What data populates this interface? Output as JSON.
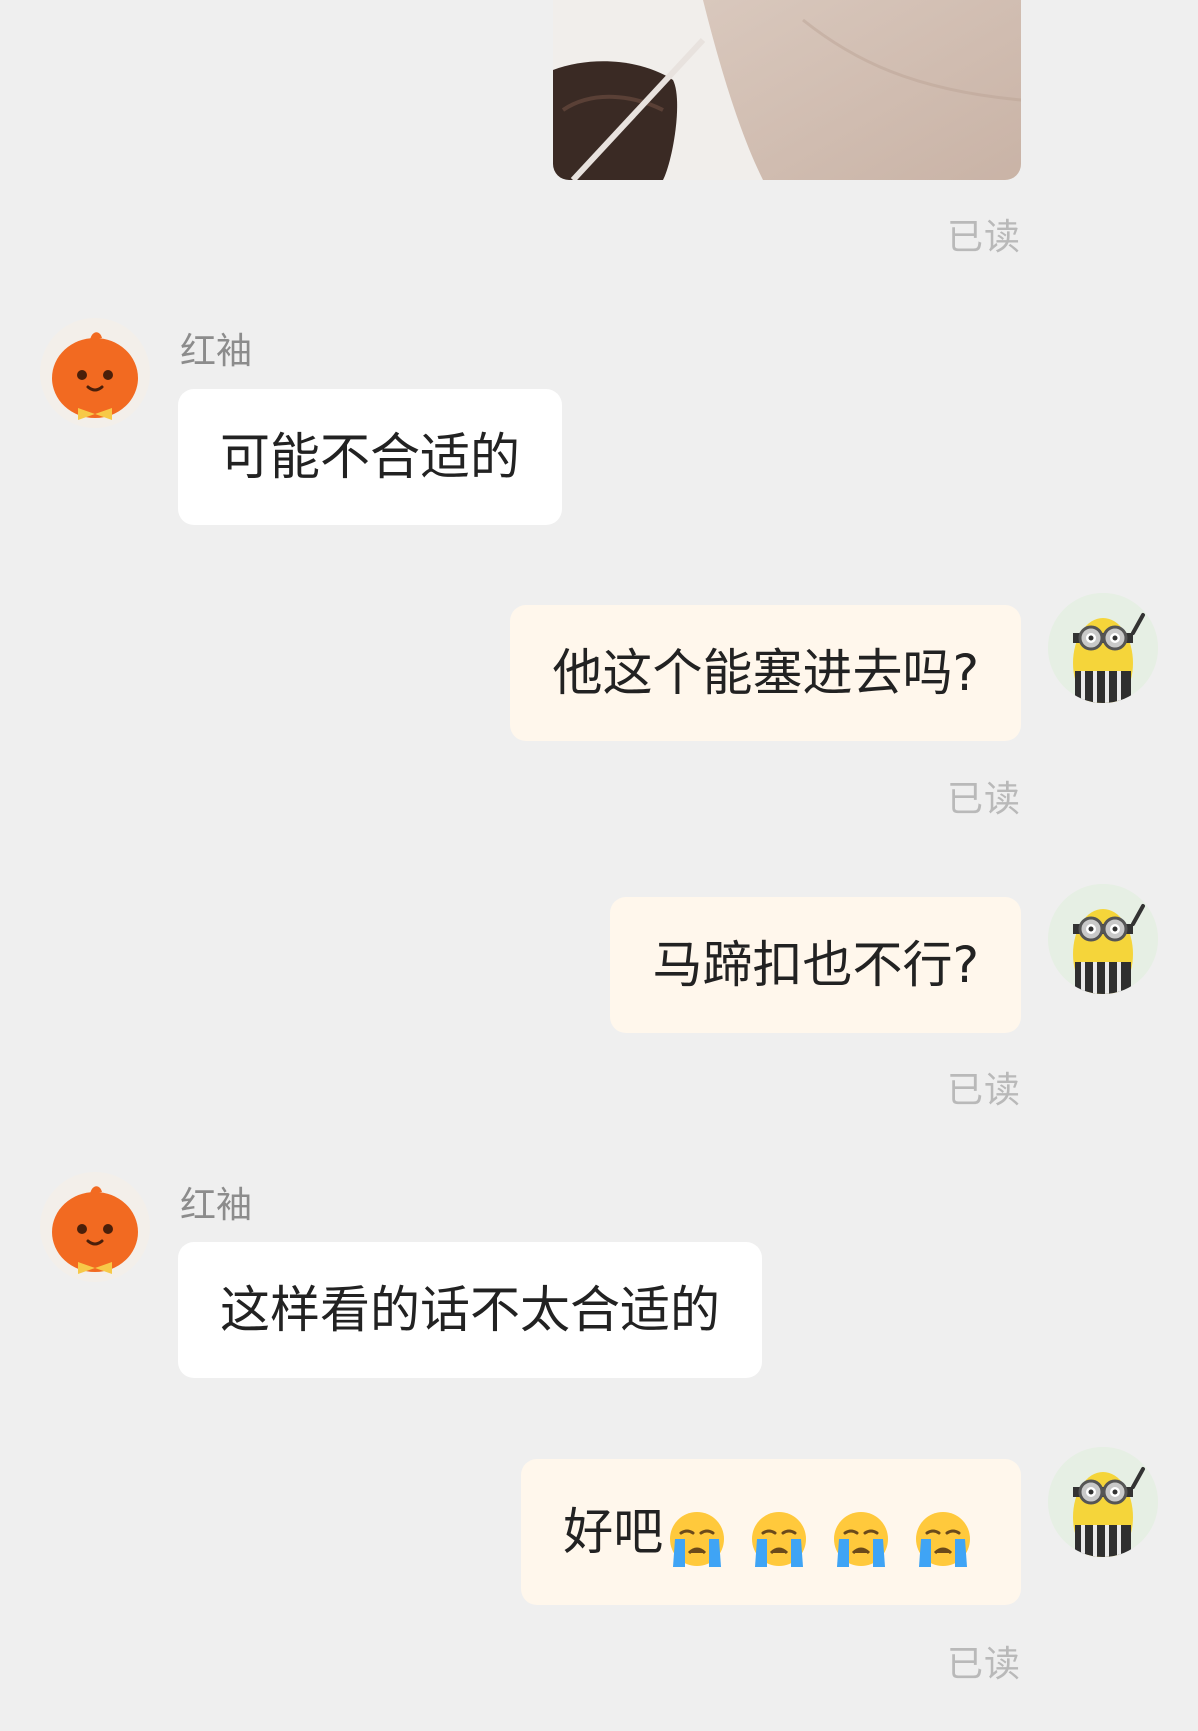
{
  "messages": [
    {
      "type": "image",
      "sender": "me",
      "read_status": "已读"
    },
    {
      "type": "text",
      "sender": "them",
      "name": "红袖",
      "text": "可能不合适的"
    },
    {
      "type": "text",
      "sender": "me",
      "text": "他这个能塞进去吗?",
      "read_status": "已读"
    },
    {
      "type": "text",
      "sender": "me",
      "text": "马蹄扣也不行?",
      "read_status": "已读"
    },
    {
      "type": "text",
      "sender": "them",
      "name": "红袖",
      "text": "这样看的话不太合适的"
    },
    {
      "type": "text",
      "sender": "me",
      "text": "好吧",
      "emoji": [
        "crying-face",
        "crying-face",
        "crying-face",
        "crying-face"
      ],
      "read_status": "已读"
    }
  ],
  "colors": {
    "background": "#efefef",
    "their_bubble": "#ffffff",
    "my_bubble": "#fff7ec",
    "read_text": "#b9b9b9",
    "name_text": "#8c8c8c",
    "pumpkin_orange": "#f26a21"
  }
}
